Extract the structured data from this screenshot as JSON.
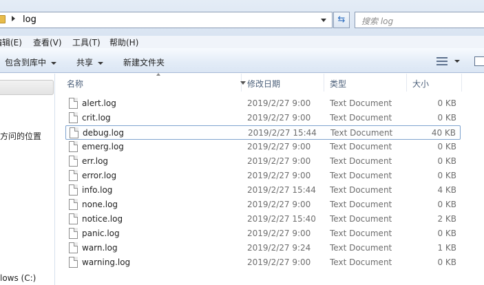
{
  "address": {
    "crumb": "log",
    "search_placeholder": "搜索 log"
  },
  "menu": [
    {
      "label": "编辑(E)"
    },
    {
      "label": "查看(V)"
    },
    {
      "label": "工具(T)"
    },
    {
      "label": "帮助(H)"
    }
  ],
  "toolbar": {
    "include_library": "包含到库中",
    "share": "共享",
    "new_folder": "新建文件夹"
  },
  "nav": {
    "recent": "方问的位置",
    "drive": "lows (C:)"
  },
  "columns": {
    "name": "名称",
    "date": "修改日期",
    "type": "类型",
    "size": "大小"
  },
  "files": [
    {
      "name": "alert.log",
      "date": "2019/2/27 9:00",
      "type": "Text Document",
      "size": "0 KB"
    },
    {
      "name": "crit.log",
      "date": "2019/2/27 9:00",
      "type": "Text Document",
      "size": "0 KB"
    },
    {
      "name": "debug.log",
      "date": "2019/2/27 15:44",
      "type": "Text Document",
      "size": "40 KB",
      "focused": true
    },
    {
      "name": "emerg.log",
      "date": "2019/2/27 9:00",
      "type": "Text Document",
      "size": "0 KB"
    },
    {
      "name": "err.log",
      "date": "2019/2/27 9:00",
      "type": "Text Document",
      "size": "0 KB"
    },
    {
      "name": "error.log",
      "date": "2019/2/27 9:00",
      "type": "Text Document",
      "size": "0 KB"
    },
    {
      "name": "info.log",
      "date": "2019/2/27 15:44",
      "type": "Text Document",
      "size": "4 KB"
    },
    {
      "name": "none.log",
      "date": "2019/2/27 9:00",
      "type": "Text Document",
      "size": "0 KB"
    },
    {
      "name": "notice.log",
      "date": "2019/2/27 15:40",
      "type": "Text Document",
      "size": "2 KB"
    },
    {
      "name": "panic.log",
      "date": "2019/2/27 9:00",
      "type": "Text Document",
      "size": "0 KB"
    },
    {
      "name": "warn.log",
      "date": "2019/2/27 9:24",
      "type": "Text Document",
      "size": "1 KB"
    },
    {
      "name": "warning.log",
      "date": "2019/2/27 9:00",
      "type": "Text Document",
      "size": "0 KB"
    }
  ]
}
